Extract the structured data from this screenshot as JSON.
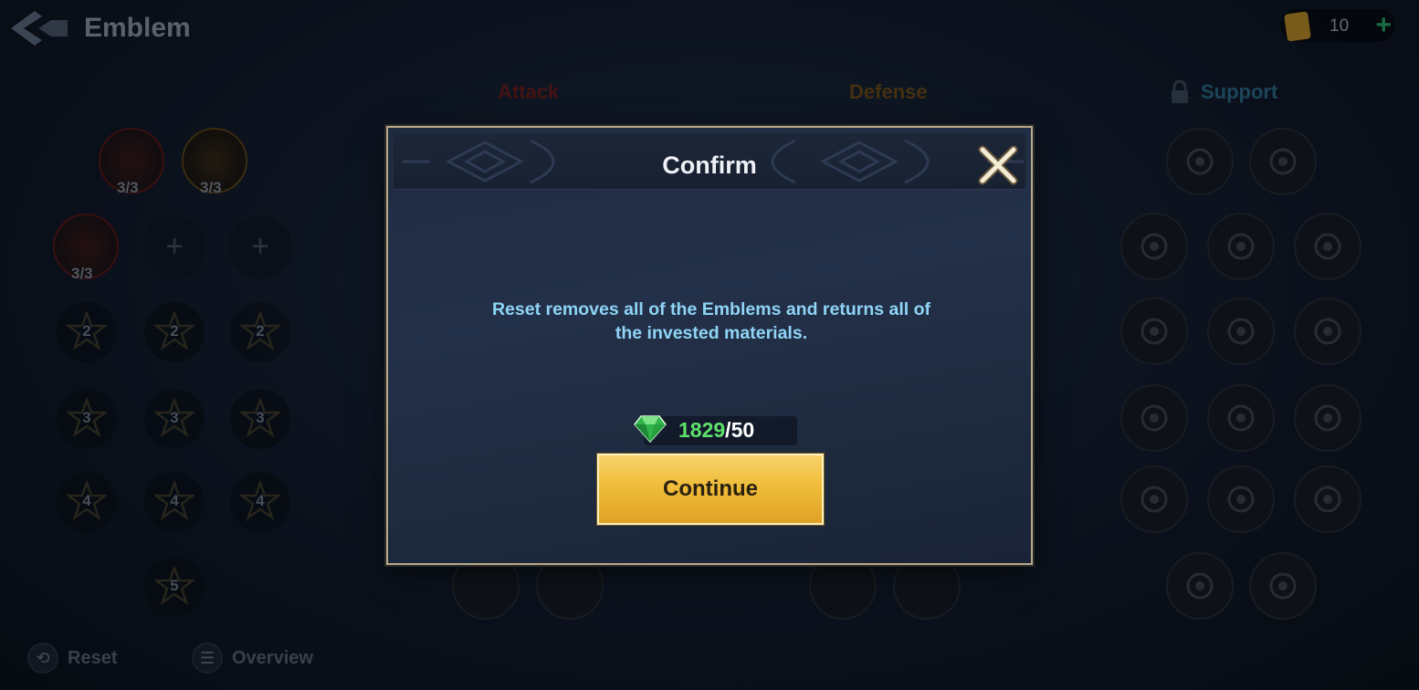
{
  "header": {
    "title": "Emblem",
    "currency": {
      "icon": "ticket-icon",
      "value": "10",
      "plus": "+"
    }
  },
  "tabs": [
    {
      "label": "Attack",
      "color": "#6a1e1e"
    },
    {
      "label": "Defense",
      "color": "#6b4a1a"
    },
    {
      "label": "Support",
      "color": "#2d6a8a",
      "locked": true
    }
  ],
  "emblem_tree": {
    "tier1_counts": [
      "3/3",
      "3/3"
    ],
    "tier1b_count": "3/3",
    "plus": "+",
    "tier_labels": {
      "t2": [
        "2",
        "2",
        "2"
      ],
      "t3": [
        "3",
        "3",
        "3"
      ],
      "t4": [
        "4",
        "4",
        "4"
      ],
      "t5": "5"
    }
  },
  "bottom_bar": {
    "reset": "Reset",
    "overview": "Overview"
  },
  "modal": {
    "title": "Confirm",
    "message": "Reset removes all of the Emblems and returns all of the invested materials.",
    "cost": {
      "have": "1829",
      "separator": "/",
      "need": "50",
      "icon": "emerald-gem-icon"
    },
    "continue_label": "Continue"
  }
}
